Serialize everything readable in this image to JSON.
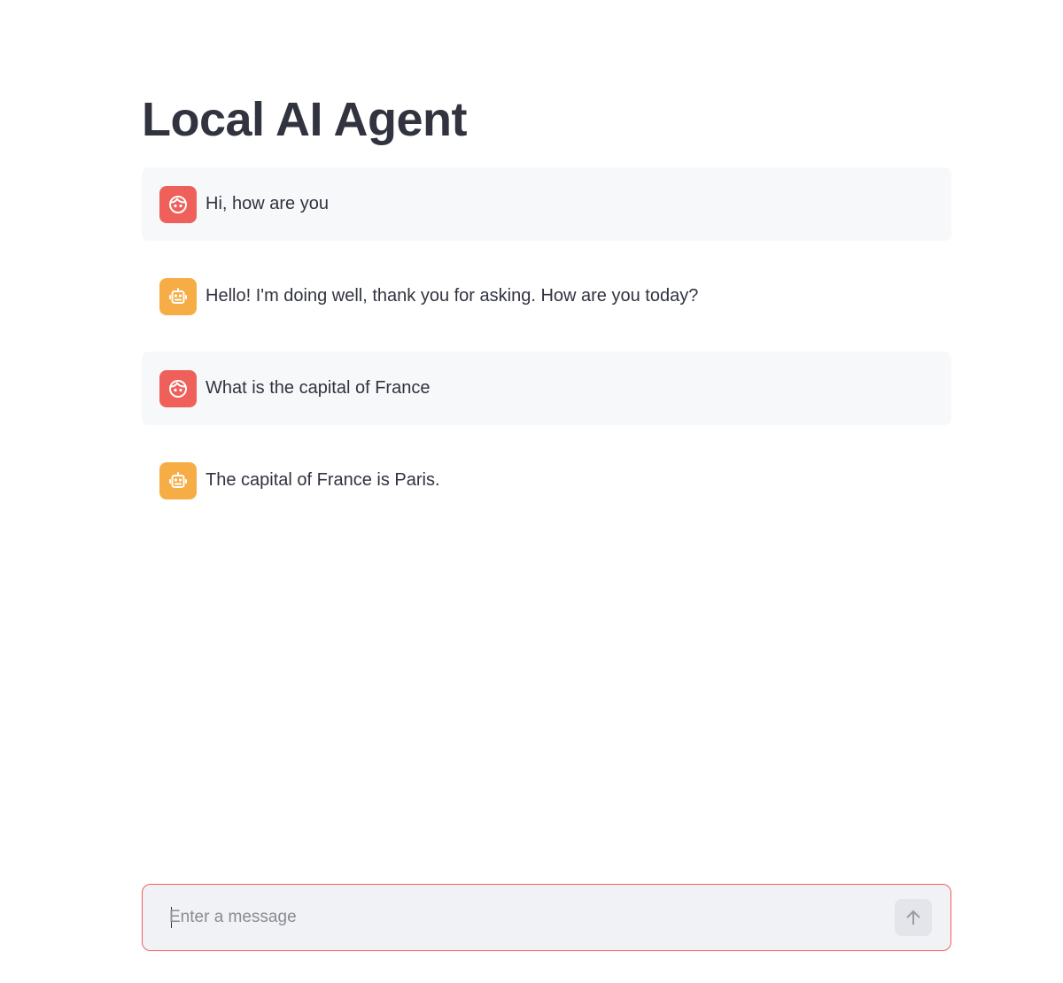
{
  "page": {
    "title": "Local AI Agent"
  },
  "messages": [
    {
      "role": "user",
      "avatar_icon": "user-face-icon",
      "text": "Hi, how are you"
    },
    {
      "role": "assistant",
      "avatar_icon": "robot-icon",
      "text": "Hello! I'm doing well, thank you for asking. How are you today?"
    },
    {
      "role": "user",
      "avatar_icon": "user-face-icon",
      "text": "What is the capital of France"
    },
    {
      "role": "assistant",
      "avatar_icon": "robot-icon",
      "text": "The capital of France is Paris."
    }
  ],
  "chat_input": {
    "placeholder": "Enter a message",
    "value": "",
    "send_icon": "arrow-up-icon"
  },
  "colors": {
    "user_avatar": "#f0605a",
    "assistant_avatar": "#f7ad45",
    "user_bubble": "#f7f8fa",
    "input_border": "#f0605a",
    "input_background": "#f0f2f6",
    "text": "#31333f"
  }
}
